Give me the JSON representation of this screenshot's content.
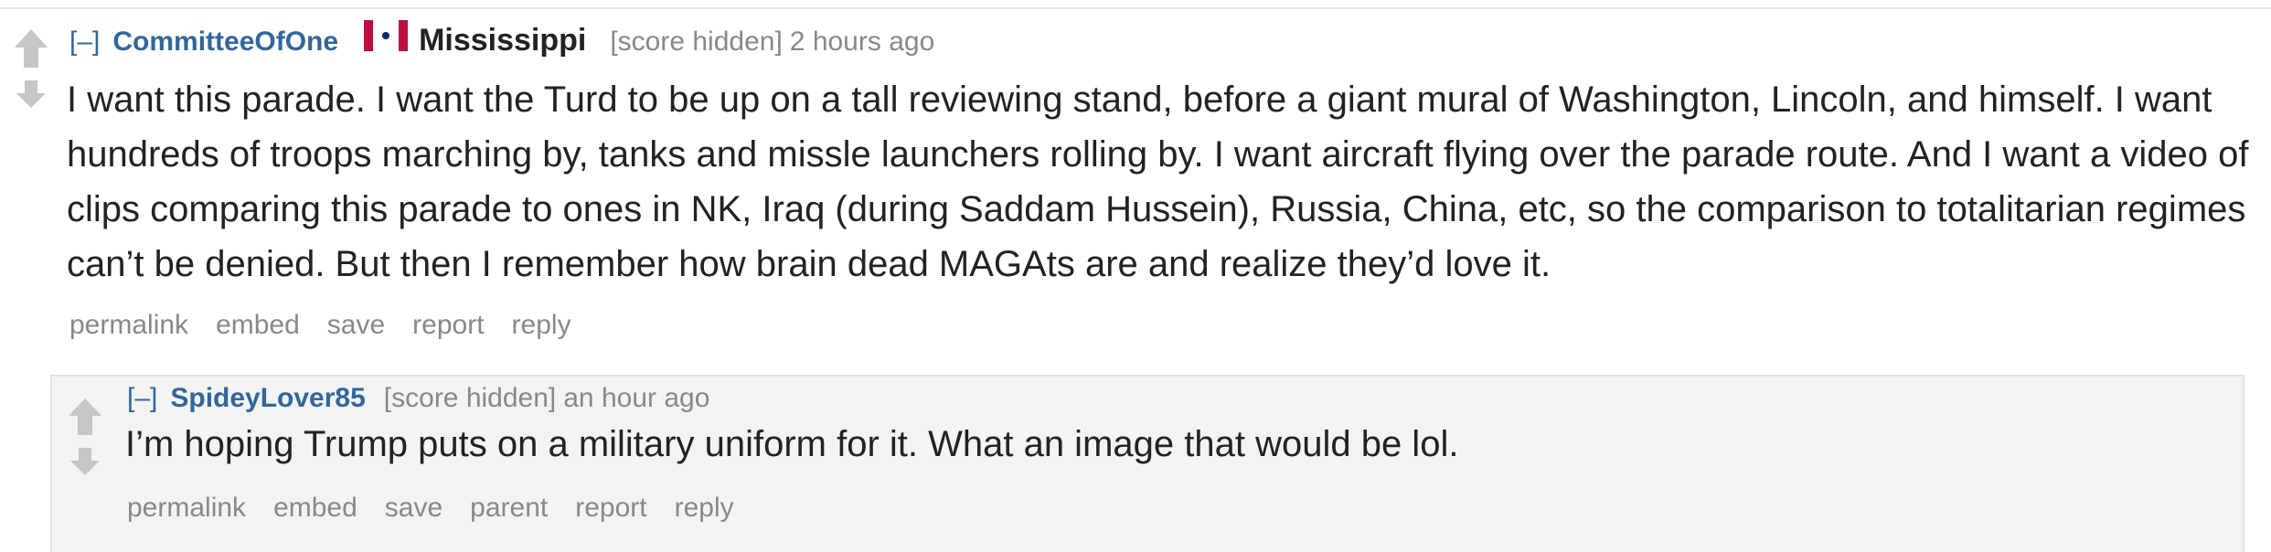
{
  "comments": [
    {
      "collapse_label": "[–]",
      "author": "CommitteeOfOne",
      "flair_text": "Mississippi",
      "flair_icon": "mississippi-flag-icon",
      "score": "[score hidden]",
      "time": "2 hours ago",
      "body": "I want this parade. I want the Turd to be up on a tall reviewing stand, before a giant mural of Washington, Lincoln, and himself. I want hundreds of troops marching by, tanks and missle launchers rolling by. I want aircraft flying over the parade route. And I want a video of clips comparing this parade to ones in NK, Iraq (during Saddam Hussein), Russia, China, etc, so the comparison to totalitarian regimes can’t be denied. But then I remember how brain dead MAGAts are and realize they’d love it.",
      "actions": {
        "permalink": "permalink",
        "embed": "embed",
        "save": "save",
        "report": "report",
        "reply": "reply"
      }
    },
    {
      "collapse_label": "[–]",
      "author": "SpideyLover85",
      "score": "[score hidden]",
      "time": "an hour ago",
      "body": "I’m hoping Trump puts on a military uniform for it. What an image that would be lol.",
      "actions": {
        "permalink": "permalink",
        "embed": "embed",
        "save": "save",
        "parent": "parent",
        "report": "report",
        "reply": "reply"
      }
    }
  ],
  "colors": {
    "author_link": "#336699",
    "muted_text": "#888888",
    "body_text": "#222222",
    "child_background": "#f3f3f3",
    "vote_arrow": "#c6c6c6",
    "flag_red": "#bf0d3e"
  }
}
